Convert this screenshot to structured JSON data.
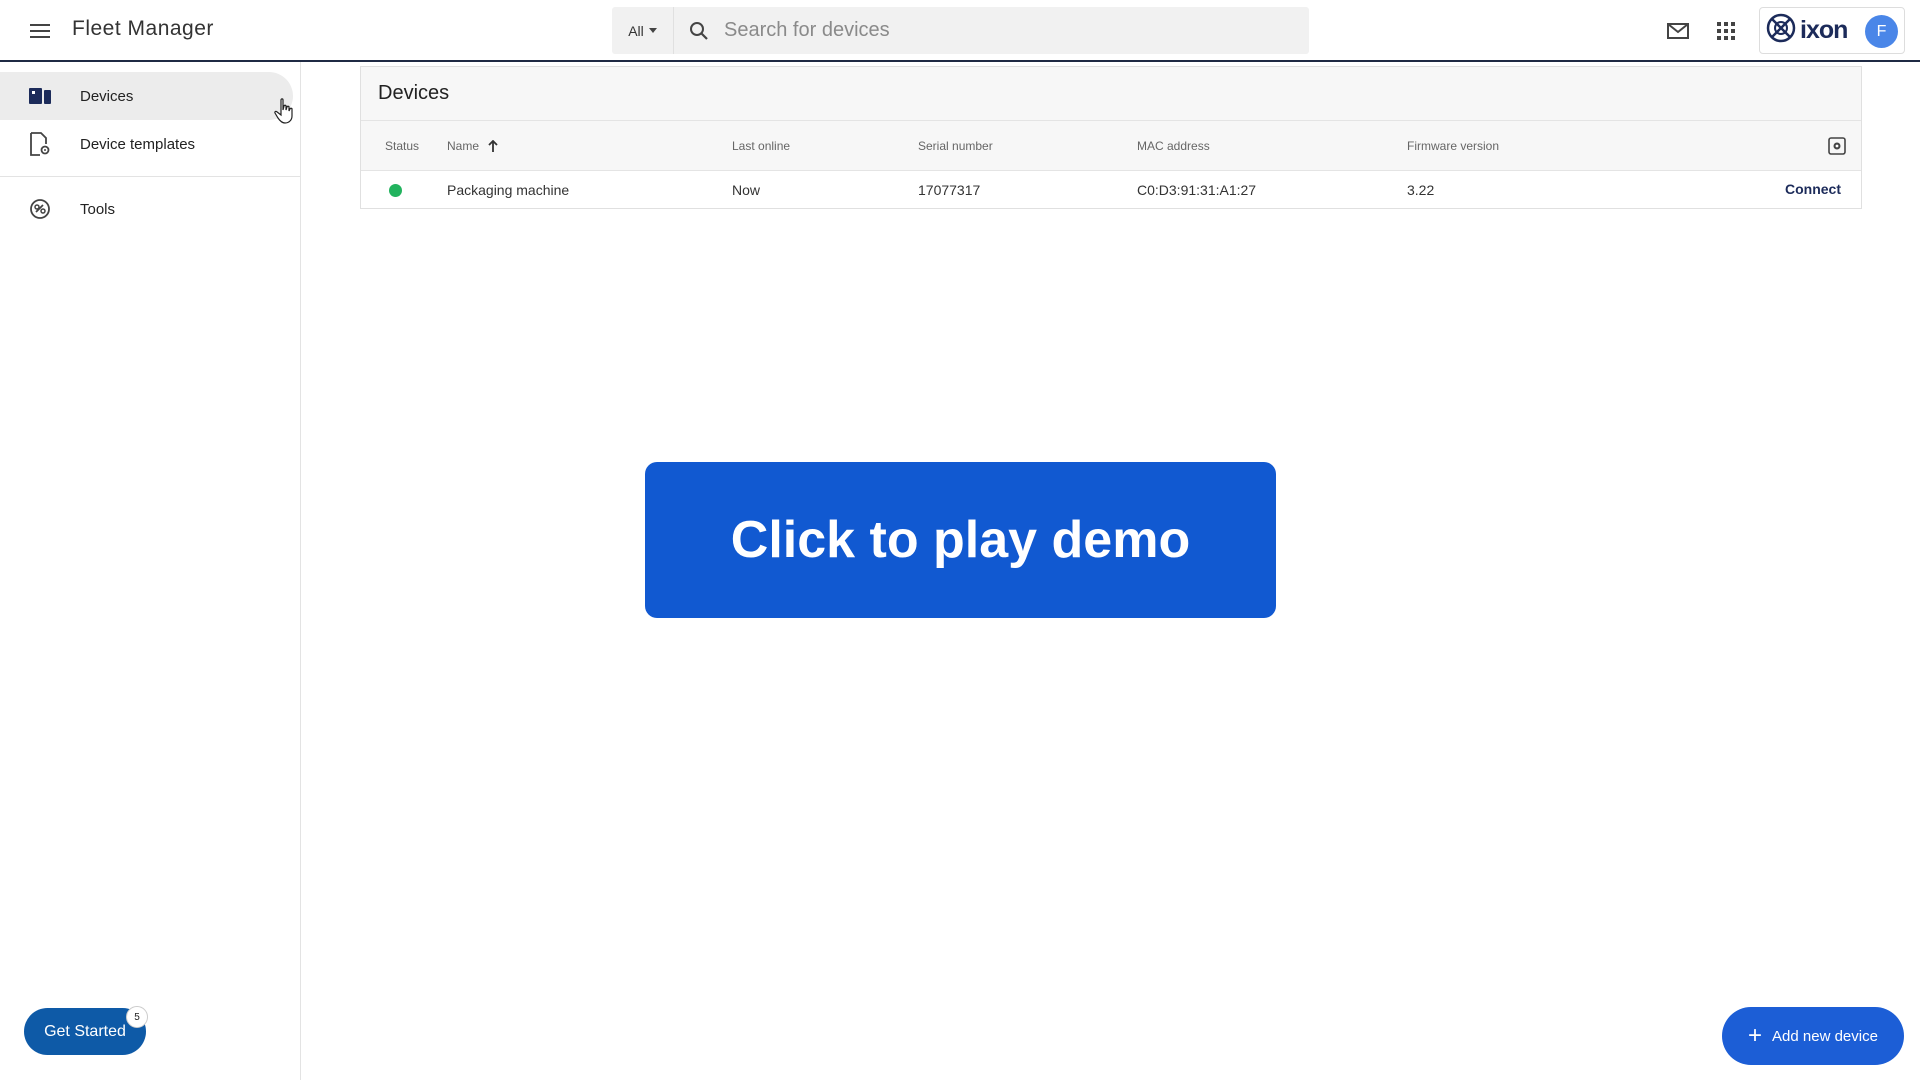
{
  "header": {
    "app_title": "Fleet Manager",
    "filter_value": "All",
    "search_placeholder": "Search for devices",
    "brand": "ixon",
    "avatar_initial": "F"
  },
  "sidebar": {
    "items": [
      {
        "label": "Devices",
        "icon": "devices-icon",
        "active": true
      },
      {
        "label": "Device templates",
        "icon": "device-template-icon",
        "active": false
      },
      {
        "label": "Tools",
        "icon": "tools-icon",
        "active": false
      }
    ],
    "get_started_label": "Get Started",
    "get_started_badge": "5"
  },
  "devices": {
    "title": "Devices",
    "columns": [
      "Status",
      "Name",
      "Last online",
      "Serial number",
      "MAC address",
      "Firmware version"
    ],
    "sort_column": "Name",
    "sort_direction": "ascending",
    "rows": [
      {
        "status": "online",
        "status_color": "#22b35e",
        "name": "Packaging machine",
        "last_online": "Now",
        "serial": "17077317",
        "mac": "C0:D3:91:31:A1:27",
        "firmware": "3.22",
        "action": "Connect"
      }
    ]
  },
  "demo_overlay": {
    "label": "Click to play demo",
    "color": "#1159d1"
  },
  "fab": {
    "label": "Add new device"
  }
}
